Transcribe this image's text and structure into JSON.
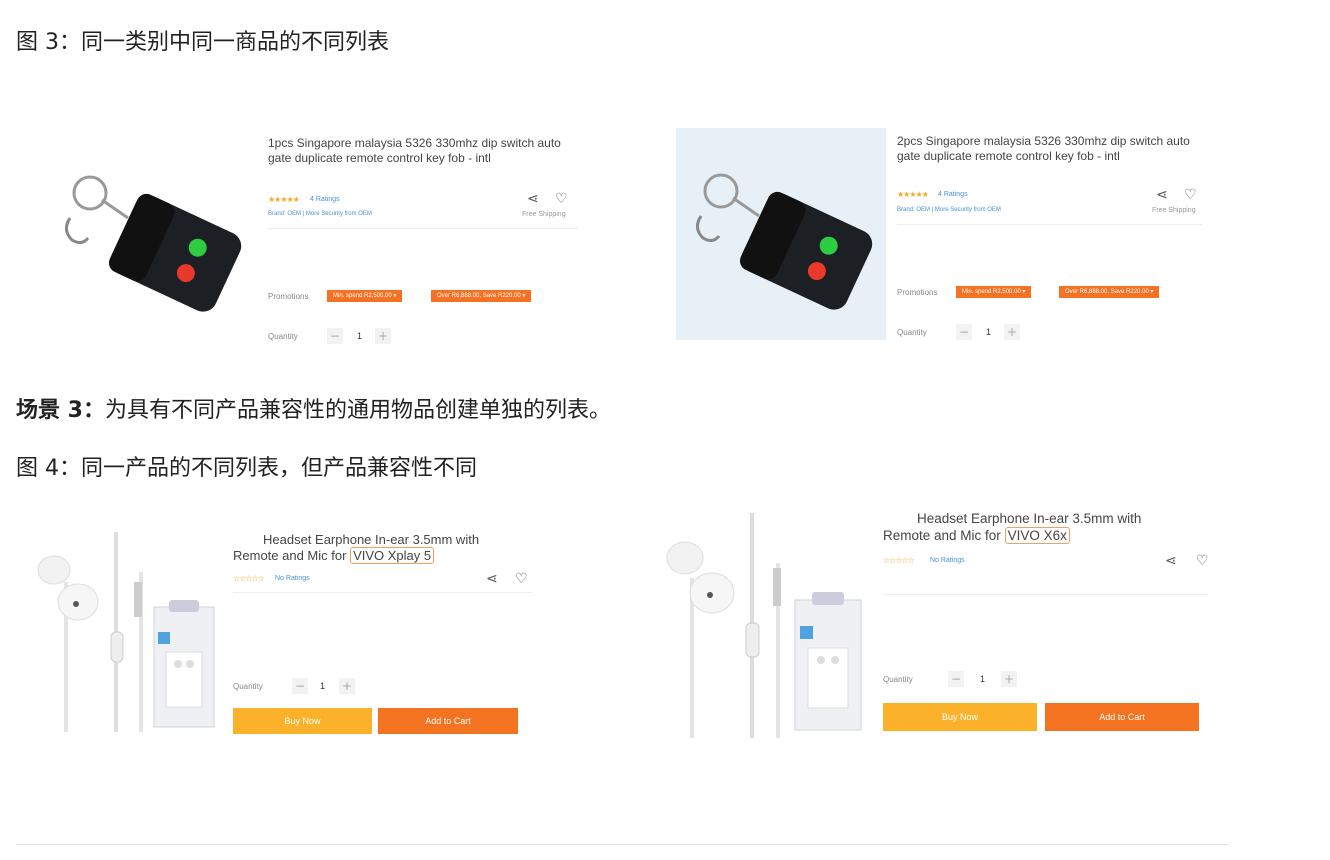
{
  "fig3_caption": "图 3：同一类别中同一商品的不同列表",
  "scenario": {
    "bold": "场景 3：",
    "text": "为具有不同产品兼容性的通用物品创建单独的列表。"
  },
  "fig4_caption": "图 4：同一产品的不同列表，但产品兼容性不同",
  "remote_listings": [
    {
      "title": "1pcs Singapore malaysia 5326 330mhz dip switch auto gate duplicate remote control key fob - intl",
      "ratings": "4 Ratings",
      "brand_line": "Brand: OEM | More Security from OEM",
      "free_shipping": "Free Shipping",
      "promotions_label": "Promotions",
      "promo1": "Min. spend R2,500.00",
      "promo2": "Over R6,888.00, Save R220.00",
      "quantity_label": "Quantity",
      "quantity": "1"
    },
    {
      "title": "2pcs Singapore malaysia 5326 330mhz dip switch auto gate duplicate remote control key fob - intl",
      "ratings": "4 Ratings",
      "brand_line": "Brand: OEM | More Security from OEM",
      "free_shipping": "Free Shipping",
      "promotions_label": "Promotions",
      "promo1": "Min. spend R2,500.00",
      "promo2": "Over R6,888.00, Save R220.00",
      "quantity_label": "Quantity",
      "quantity": "1"
    }
  ],
  "earphone_listings": [
    {
      "title_line1": "Headset Earphone In-ear 3.5mm with",
      "title_line2": "Remote and Mic for",
      "compat": "VIVO Xplay 5",
      "ratings": "No Ratings",
      "quantity_label": "Quantity",
      "quantity": "1",
      "buy_now": "Buy Now",
      "add_to_cart": "Add to Cart"
    },
    {
      "title_line1": "Headset Earphone In-ear 3.5mm with",
      "title_line2": "Remote and Mic for",
      "compat": "VIVO X6x",
      "ratings": "No Ratings",
      "quantity_label": "Quantity",
      "quantity": "1",
      "buy_now": "Buy Now",
      "add_to_cart": "Add to Cart"
    }
  ],
  "icons": {
    "share": "share-icon",
    "heart": "heart-icon"
  },
  "colors": {
    "orange": "#f57224",
    "yellow": "#fbb12a",
    "star": "#f5a623"
  }
}
